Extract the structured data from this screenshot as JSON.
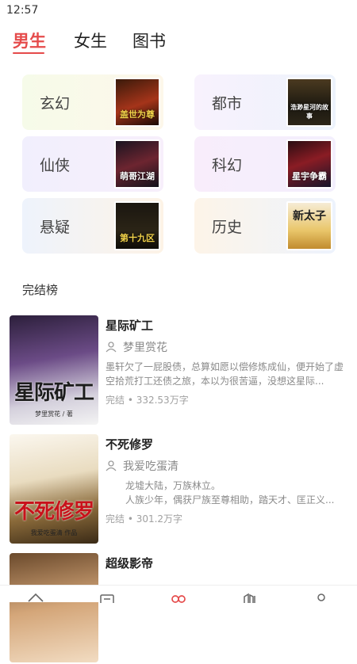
{
  "status_bar": {
    "time": "12:57"
  },
  "tabs": [
    {
      "label": "男生",
      "active": true
    },
    {
      "label": "女生",
      "active": false
    },
    {
      "label": "图书",
      "active": false
    }
  ],
  "genres": [
    {
      "label": "玄幻",
      "cover_text": "盖世为尊"
    },
    {
      "label": "都市",
      "cover_text": "浩渺星河的故事"
    },
    {
      "label": "仙侠",
      "cover_text": "萌哥江湖"
    },
    {
      "label": "科幻",
      "cover_text": "星宇争霸"
    },
    {
      "label": "悬疑",
      "cover_text": "第十九区"
    },
    {
      "label": "历史",
      "cover_text": "新太子"
    }
  ],
  "section_title": "完结榜",
  "books": [
    {
      "title": "星际矿工",
      "author": "梦里赏花",
      "desc": "墨轩欠了一屁股债，总算如愿以偿修炼成仙，便开始了虚空拾荒打工还债之旅，本以为很苦逼，没想这星际...",
      "meta": "完结 • 332.53万字",
      "cover_title": "星际矿工",
      "cover_author": "梦里赏花 / 著"
    },
    {
      "title": "不死修罗",
      "author": "我爱吃蛋清",
      "desc": "龙墟大陆，万族林立。\n人族少年，偶获尸族至尊相助，踏天才、匡正义...",
      "meta": "完结 • 301.2万字",
      "cover_title": "不死修罗",
      "cover_author": "我爱吃蛋清 作品"
    },
    {
      "title": "超级影帝",
      "author": "",
      "desc": "",
      "meta": "",
      "cover_title": "",
      "cover_author": ""
    }
  ],
  "bottom_nav": [
    "home-icon",
    "list-icon",
    "discover-icon",
    "bookshelf-icon",
    "profile-icon"
  ],
  "colors": {
    "accent": "#e54b4b",
    "text_gray": "#8a8a8a"
  }
}
